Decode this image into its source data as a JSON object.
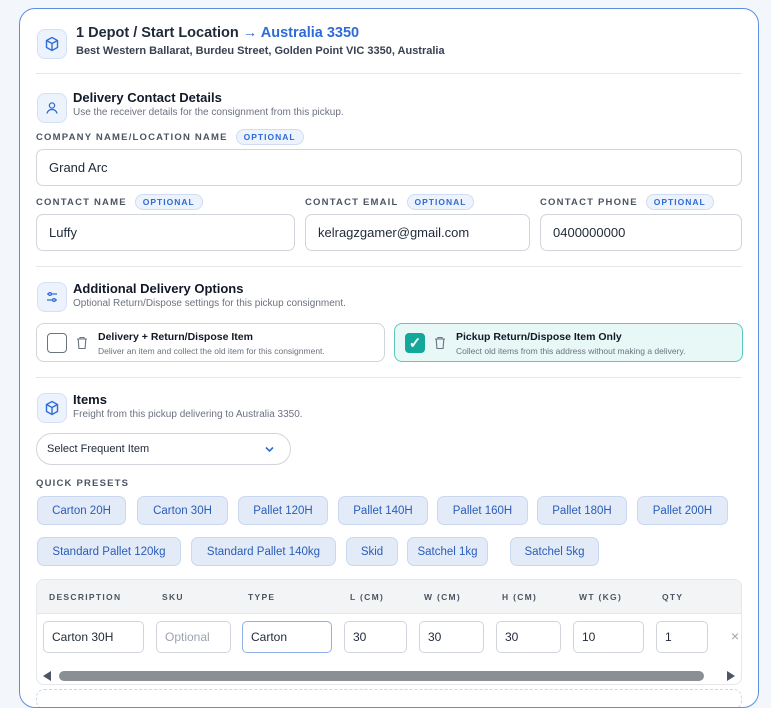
{
  "depot": {
    "title": "1 Depot / Start Location",
    "arrow": "→",
    "destination": "Australia 3350",
    "address": "Best Western Ballarat, Burdeu Street, Golden Point VIC 3350, Australia"
  },
  "contact_section": {
    "title": "Delivery Contact Details",
    "subtitle": "Use the receiver details for the consignment from this pickup.",
    "company_label": "COMPANY NAME/LOCATION NAME",
    "company_value": "Grand Arc",
    "name_label": "CONTACT NAME",
    "name_value": "Luffy",
    "email_label": "CONTACT EMAIL",
    "email_value": "kelragzgamer@gmail.com",
    "phone_label": "CONTACT PHONE",
    "phone_value": "0400000000",
    "optional_badge": "OPTIONAL"
  },
  "options_section": {
    "title": "Additional Delivery Options",
    "subtitle": "Optional Return/Dispose settings for this pickup consignment.",
    "options": [
      {
        "title": "Delivery + Return/Dispose Item",
        "desc": "Deliver an item and collect the old item for this consignment.",
        "checked": false
      },
      {
        "title": "Pickup Return/Dispose Item Only",
        "desc": "Collect old items from this address without making a delivery.",
        "checked": true
      }
    ],
    "check_mark": "✓"
  },
  "items_section": {
    "title": "Items",
    "subtitle": "Freight from this pickup delivering to Australia 3350.",
    "frequent_select": "Select Frequent Item",
    "presets_label": "QUICK PRESETS",
    "presets": [
      "Carton 20H",
      "Carton 30H",
      "Pallet 120H",
      "Pallet 140H",
      "Pallet 160H",
      "Pallet 180H",
      "Pallet 200H",
      "Standard Pallet 120kg",
      "Standard Pallet 140kg",
      "Skid",
      "Satchel 1kg",
      "Satchel 5kg"
    ]
  },
  "table": {
    "headers": [
      "DESCRIPTION",
      "SKU",
      "TYPE",
      "L (CM)",
      "W (CM)",
      "H (CM)",
      "WT (KG)",
      "QTY"
    ],
    "row": {
      "description": "Carton 30H",
      "sku_placeholder": "Optional",
      "type": "Carton",
      "l": "30",
      "w": "30",
      "h": "30",
      "wt": "10",
      "qty": "1"
    },
    "remove": "×"
  },
  "colors": {
    "accent": "#2f6bd8",
    "teal": "#14a89b",
    "border": "#5b8fe0"
  }
}
